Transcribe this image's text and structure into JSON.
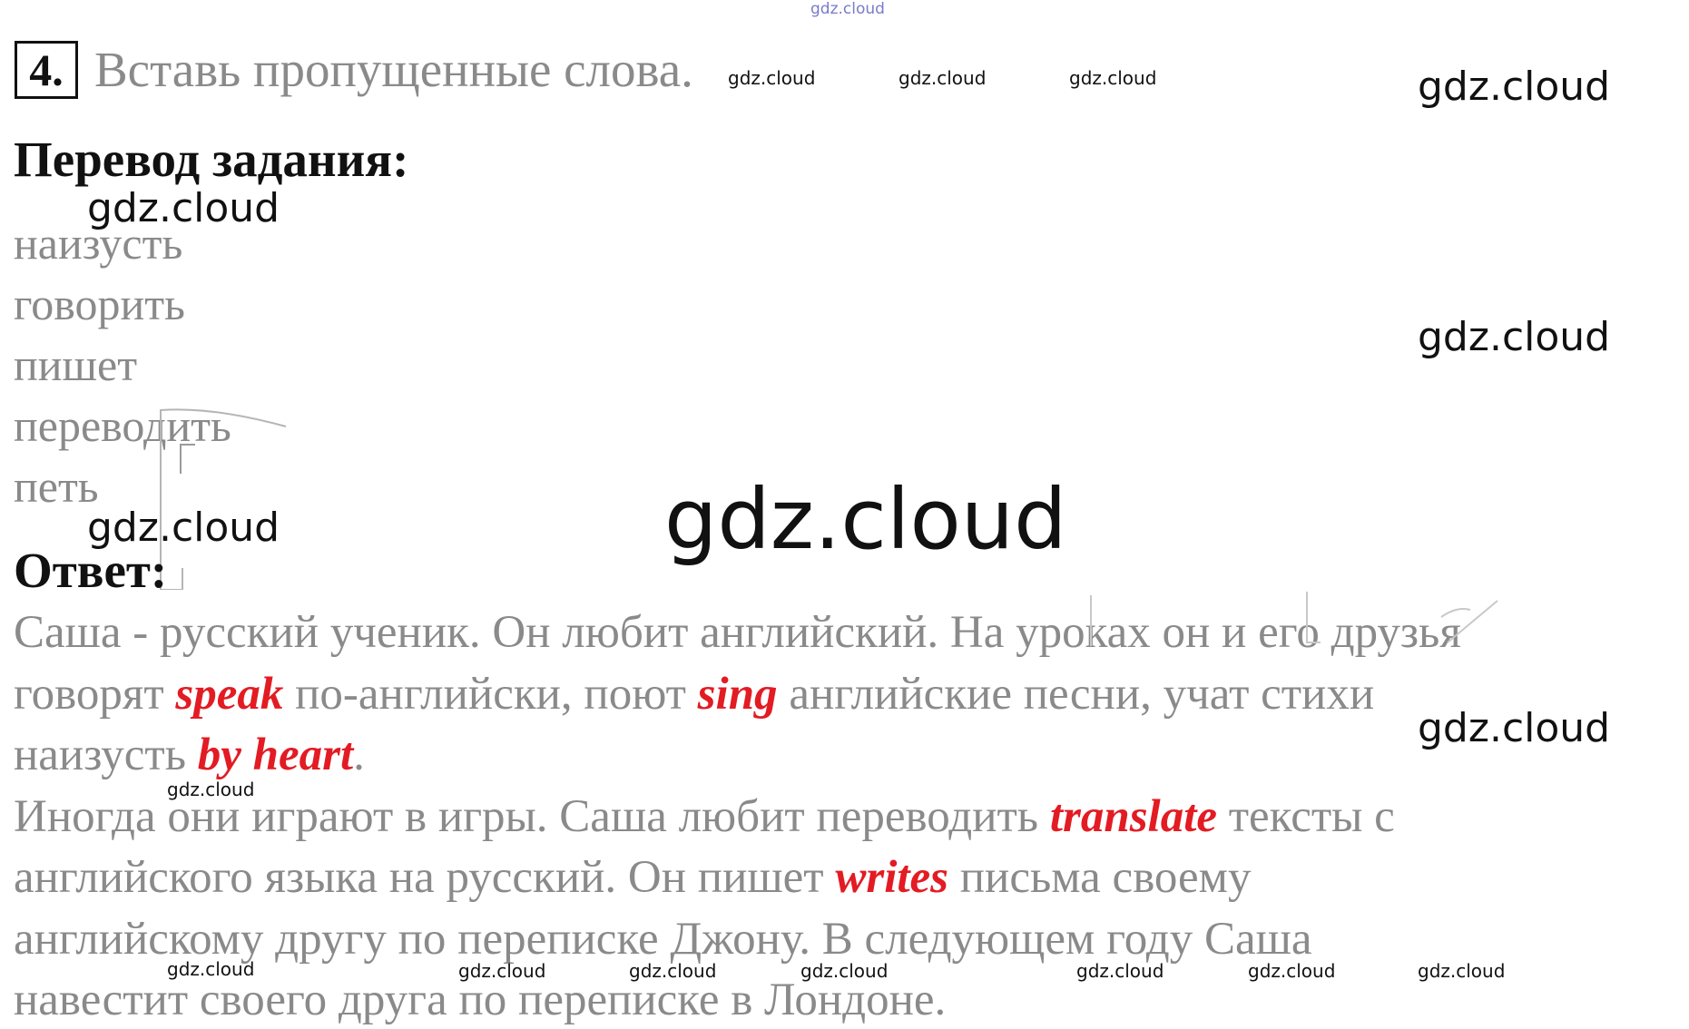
{
  "task": {
    "number": "4.",
    "title": "Вставь пропущенные слова."
  },
  "translation": {
    "heading": "Перевод задания:",
    "words": [
      "наизусть",
      "говорить",
      "пишет",
      "переводить",
      "петь"
    ]
  },
  "answer": {
    "heading": "Ответ:",
    "lines": [
      [
        {
          "t": "Саша - русский ученик. Он любит английский. На уроках он и его друзья"
        }
      ],
      [
        {
          "t": "говорят "
        },
        {
          "t": "speak",
          "a": true
        },
        {
          "t": " по-английски, поют "
        },
        {
          "t": "sing",
          "a": true
        },
        {
          "t": " английские песни, учат стихи"
        }
      ],
      [
        {
          "t": "наизусть "
        },
        {
          "t": "by heart",
          "a": true
        },
        {
          "t": "."
        }
      ],
      [
        {
          "t": "Иногда они играют в игры. Саша любит переводить "
        },
        {
          "t": "translate",
          "a": true
        },
        {
          "t": " тексты с"
        }
      ],
      [
        {
          "t": "английского языка на русский. Он пишет "
        },
        {
          "t": "writes",
          "a": true
        },
        {
          "t": " письма своему"
        }
      ],
      [
        {
          "t": "английскому другу по переписке Джону. В следующем году Саша"
        }
      ],
      [
        {
          "t": "навестит своего друга по переписке в Лондоне."
        }
      ]
    ]
  },
  "watermarks": {
    "text": "gdz.cloud"
  },
  "colors": {
    "answer_highlight": "#e31b23",
    "body_text": "#8a8a8a",
    "heading_text": "#111111"
  }
}
